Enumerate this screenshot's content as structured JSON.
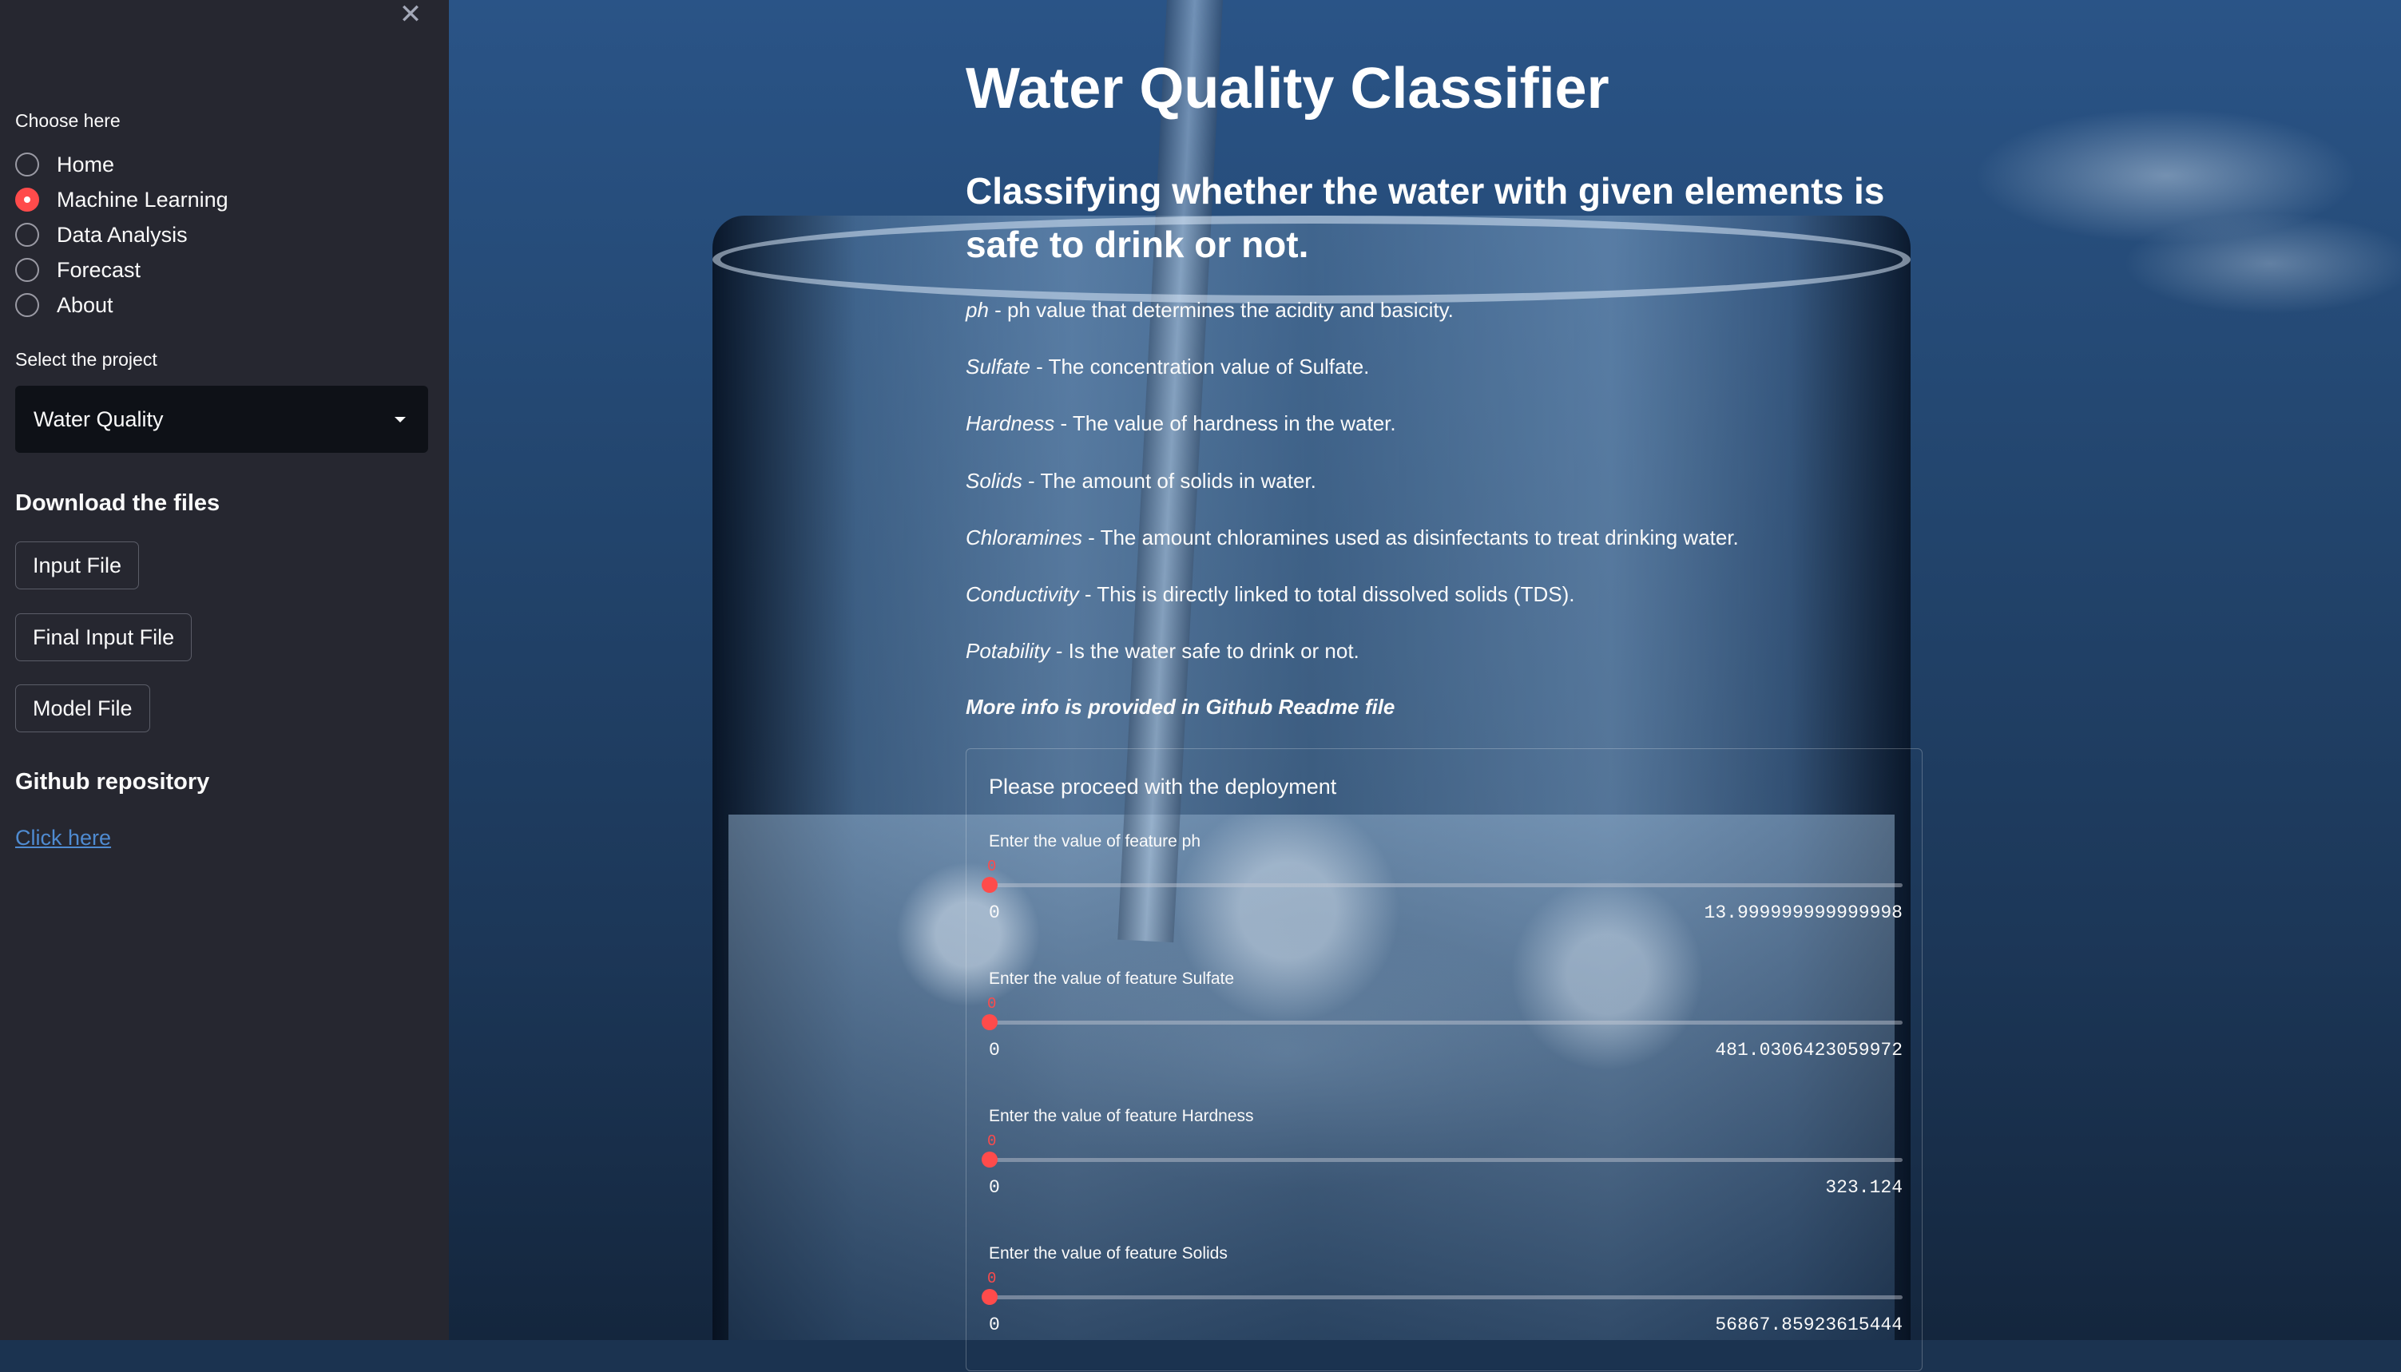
{
  "sidebar": {
    "close_icon": "close-icon",
    "nav_label": "Choose here",
    "nav_items": [
      {
        "label": "Home",
        "selected": false
      },
      {
        "label": "Machine Learning",
        "selected": true
      },
      {
        "label": "Data Analysis",
        "selected": false
      },
      {
        "label": "Forecast",
        "selected": false
      },
      {
        "label": "About",
        "selected": false
      }
    ],
    "project_label": "Select the project",
    "project_value": "Water Quality",
    "download_heading": "Download the files",
    "download_buttons": [
      "Input File",
      "Final Input File",
      "Model File"
    ],
    "github_heading": "Github repository",
    "github_link": "Click here"
  },
  "main": {
    "title": "Water Quality Classifier",
    "subtitle": "Classifying whether the water with given elements is safe to drink or not.",
    "features": [
      {
        "name": "ph",
        "desc": " - ph value that determines the acidity and basicity."
      },
      {
        "name": "Sulfate",
        "desc": " - The concentration value of Sulfate."
      },
      {
        "name": "Hardness",
        "desc": " - The value of hardness in the water."
      },
      {
        "name": "Solids",
        "desc": " - The amount of solids in water."
      },
      {
        "name": "Chloramines",
        "desc": " - The amount chloramines used as disinfectants to treat drinking water."
      },
      {
        "name": "Conductivity",
        "desc": " - This is directly linked to total dissolved solids (TDS)."
      },
      {
        "name": "Potability",
        "desc": " - Is the water safe to drink or not."
      }
    ],
    "more_info": "More info is provided in Github Readme file",
    "form": {
      "heading": "Please proceed with the deployment",
      "sliders": [
        {
          "label": "Enter the value of feature ph",
          "value": "0",
          "min": "0",
          "max": "13.999999999999998"
        },
        {
          "label": "Enter the value of feature Sulfate",
          "value": "0",
          "min": "0",
          "max": "481.0306423059972"
        },
        {
          "label": "Enter the value of feature Hardness",
          "value": "0",
          "min": "0",
          "max": "323.124"
        },
        {
          "label": "Enter the value of feature Solids",
          "value": "0",
          "min": "0",
          "max": "56867.85923615444"
        }
      ]
    }
  },
  "colors": {
    "accent": "#ff4b4b",
    "sidebar_bg": "#262730",
    "link": "#4f8bd1"
  }
}
